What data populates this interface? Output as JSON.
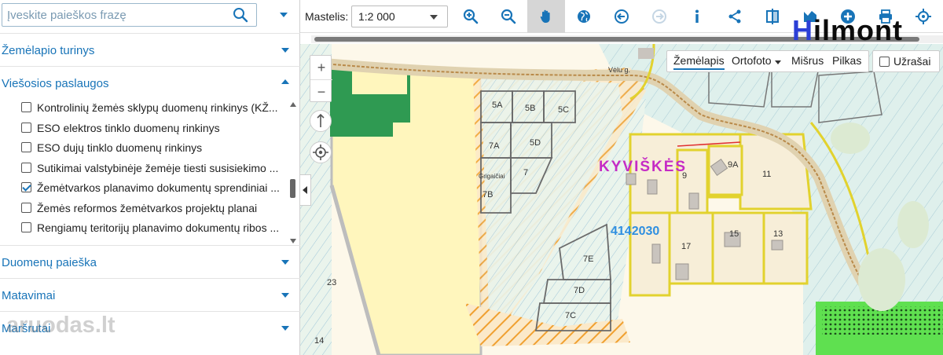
{
  "search": {
    "placeholder": "Įveskite paieškos frazę"
  },
  "sections": {
    "map_content": "Žemėlapio turinys",
    "public_services": "Viešosios paslaugos",
    "data_search": "Duomenų paieška",
    "measurements": "Matavimai",
    "routes": "Maršrutai"
  },
  "layers": [
    {
      "label": "Kontrolinių žemės sklypų duomenų rinkinys (KŽ...",
      "checked": false
    },
    {
      "label": "ESO elektros tinklo duomenų rinkinys",
      "checked": false
    },
    {
      "label": "ESO dujų tinklo duomenų rinkinys",
      "checked": false
    },
    {
      "label": "Sutikimai valstybinėje žemėje tiesti susisiekimo ...",
      "checked": false
    },
    {
      "label": "Žemėtvarkos planavimo dokumentų sprendiniai ...",
      "checked": true
    },
    {
      "label": "Žemės reformos žemėtvarkos projektų planai",
      "checked": false
    },
    {
      "label": "Rengiamų teritorijų planavimo dokumentų ribos ...",
      "checked": false
    }
  ],
  "toolbar": {
    "scale_label": "Mastelis:",
    "scale_value": "1:2 000",
    "tools": [
      "zoom-in-icon",
      "zoom-out-icon",
      "pan-hand-icon",
      "globe-icon",
      "back-icon",
      "forward-icon",
      "info-icon",
      "share-icon",
      "compare-icon",
      "bookmark-icon",
      "add-icon",
      "print-icon",
      "locate-icon"
    ],
    "active_tool": "pan-hand-icon"
  },
  "brand": {
    "first": "H",
    "rest": "ilmont"
  },
  "watermark": "aruodas.lt",
  "basemap": {
    "options": [
      "Žemėlapis",
      "Ortofoto",
      "Mišrus",
      "Pilkas"
    ],
    "active": "Žemėlapis",
    "labels_toggle": "Užrašai",
    "labels_checked": false
  },
  "map": {
    "place_name": "KYVIŠKĖS",
    "plot_number": "4142030",
    "parcel_labels": [
      "5A",
      "5B",
      "5C",
      "7A",
      "5D",
      "7",
      "7B",
      "Grigaičiai",
      "7E",
      "7D",
      "7C",
      "9",
      "9A",
      "11",
      "17",
      "15",
      "13",
      "23",
      "14",
      "Vėlu g."
    ],
    "zoom_in": "+",
    "zoom_out": "−"
  },
  "colors": {
    "accent": "#1874b8",
    "parcel_yellow": "#f1e046",
    "orange_hatch": "#f0a030",
    "green": "#2f9a52",
    "plot_blue": "#2f8fe0",
    "place_magenta": "#c52bc5"
  }
}
